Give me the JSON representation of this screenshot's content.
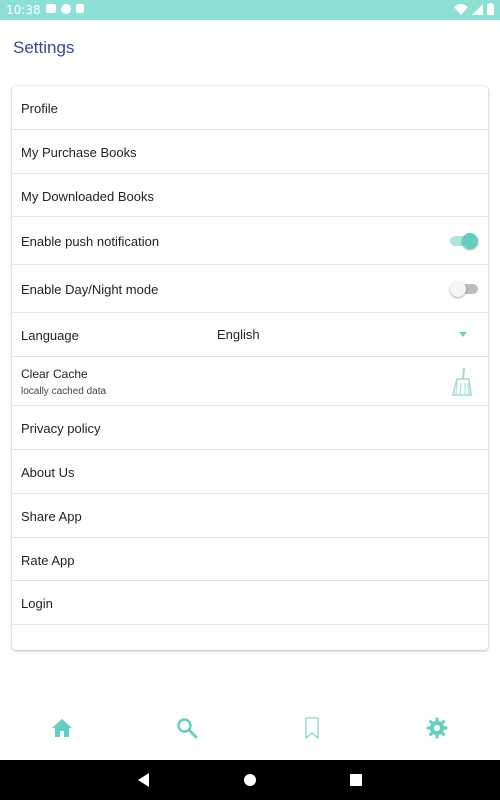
{
  "status_bar": {
    "time": "10:38",
    "icons": [
      "keyboard-icon",
      "notification-icon",
      "sd-card-icon",
      "wifi-icon",
      "signal-icon",
      "battery-icon"
    ]
  },
  "page": {
    "title": "Settings"
  },
  "settings": {
    "profile": "Profile",
    "purchase_books": "My Purchase Books",
    "downloaded_books": "My Downloaded Books",
    "push_notification": {
      "label": "Enable push notification",
      "enabled": true
    },
    "day_night_mode": {
      "label": "Enable Day/Night mode",
      "enabled": false
    },
    "language": {
      "label": "Language",
      "value": "English"
    },
    "clear_cache": {
      "title": "Clear Cache",
      "subtitle": "locally cached data",
      "icon": "broom-icon"
    },
    "privacy_policy": "Privacy policy",
    "about_us": "About Us",
    "share_app": "Share App",
    "rate_app": "Rate App",
    "login": "Login"
  },
  "bottom_nav": {
    "items": [
      {
        "icon": "home-icon"
      },
      {
        "icon": "search-icon"
      },
      {
        "icon": "bookmark-icon"
      },
      {
        "icon": "gear-icon",
        "active": true
      }
    ]
  },
  "colors": {
    "accent": "#63cfc2",
    "status_bar": "#8de0d6",
    "title": "#2f4a9e",
    "toggle_off_track": "#bdbdbd",
    "toggle_off_thumb": "#f5f5f5"
  }
}
